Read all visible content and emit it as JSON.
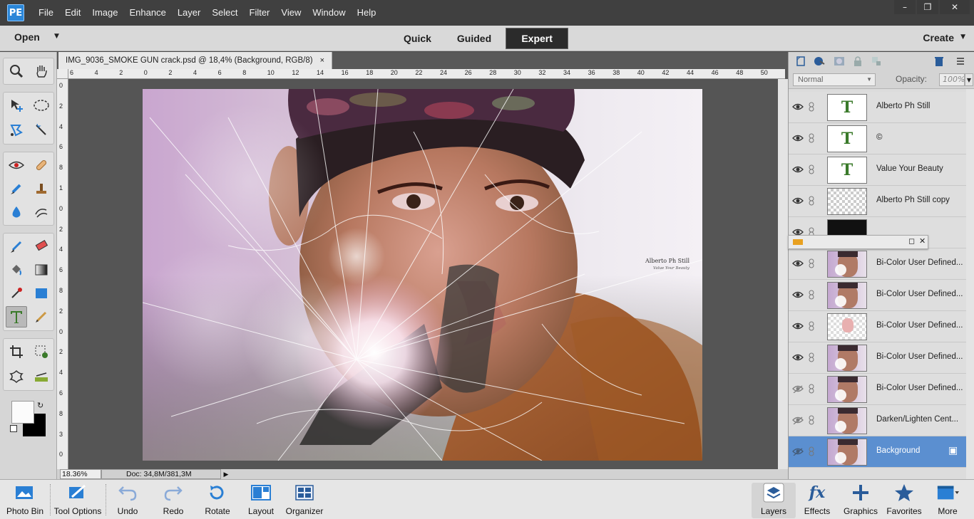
{
  "menubar": {
    "logo": "PE",
    "items": [
      "File",
      "Edit",
      "Image",
      "Enhance",
      "Layer",
      "Select",
      "Filter",
      "View",
      "Window",
      "Help"
    ],
    "window_buttons": [
      "minimize",
      "restore",
      "close"
    ]
  },
  "modebar": {
    "open_label": "Open",
    "tabs": [
      "Quick",
      "Guided",
      "Expert"
    ],
    "active_tab": "Expert",
    "create_label": "Create"
  },
  "document": {
    "tab_title": "IMG_9036_SMOKE GUN crack.psd @ 18,4% (Background, RGB/8)",
    "tab_close": "×",
    "ruler_h": [
      "6",
      "4",
      "2",
      "0",
      "2",
      "4",
      "6",
      "8",
      "10",
      "12",
      "14",
      "16",
      "18",
      "20",
      "22",
      "24",
      "26",
      "28",
      "30",
      "32",
      "34",
      "36",
      "38",
      "40",
      "42",
      "44",
      "46",
      "48",
      "50"
    ],
    "ruler_v": [
      "0",
      "2",
      "4",
      "6",
      "8",
      "1",
      "0",
      "2",
      "4",
      "6",
      "8",
      "2",
      "0",
      "2",
      "4",
      "6",
      "8",
      "3",
      "0"
    ],
    "zoom": "18.36%",
    "doc_info": "Doc: 34,8M/381,3M",
    "watermark_title": "Alberto Ph Still",
    "watermark_sub": "Value Your Beauty"
  },
  "layers_panel": {
    "blend_mode": "Normal",
    "opacity_label": "Opacity:",
    "opacity_value": "100%",
    "layers": [
      {
        "name": "Alberto Ph Still",
        "type": "text"
      },
      {
        "name": "©",
        "type": "text"
      },
      {
        "name": "Value Your Beauty",
        "type": "text"
      },
      {
        "name": "Alberto Ph Still copy",
        "type": "transparent"
      },
      {
        "name": "",
        "type": "dark"
      },
      {
        "name": "Bi-Color User Defined...",
        "type": "photo"
      },
      {
        "name": "Bi-Color User Defined...",
        "type": "photo"
      },
      {
        "name": "Bi-Color User Defined...",
        "type": "partial"
      },
      {
        "name": "Bi-Color User Defined...",
        "type": "photo"
      },
      {
        "name": "Bi-Color User Defined...",
        "type": "photo",
        "hidden": true
      },
      {
        "name": "Darken/Lighten Cent...",
        "type": "photo",
        "hidden": true
      },
      {
        "name": "Background",
        "type": "photo",
        "selected": true,
        "hidden": true
      }
    ]
  },
  "bottombar": {
    "left": [
      {
        "label": "Photo Bin",
        "icon": "photo-bin-icon"
      },
      {
        "label": "Tool Options",
        "icon": "tool-options-icon"
      },
      {
        "label": "Undo",
        "icon": "undo-icon"
      },
      {
        "label": "Redo",
        "icon": "redo-icon"
      },
      {
        "label": "Rotate",
        "icon": "rotate-icon"
      },
      {
        "label": "Layout",
        "icon": "layout-icon"
      },
      {
        "label": "Organizer",
        "icon": "organizer-icon"
      }
    ],
    "right": [
      {
        "label": "Layers",
        "icon": "layers-icon"
      },
      {
        "label": "Effects",
        "icon": "effects-icon"
      },
      {
        "label": "Graphics",
        "icon": "graphics-icon"
      },
      {
        "label": "Favorites",
        "icon": "favorites-icon"
      },
      {
        "label": "More",
        "icon": "more-icon"
      }
    ]
  },
  "colors": {
    "accent_blue": "#2a7fd4",
    "selected_layer": "#5b8fd0",
    "menubar": "#404040"
  }
}
